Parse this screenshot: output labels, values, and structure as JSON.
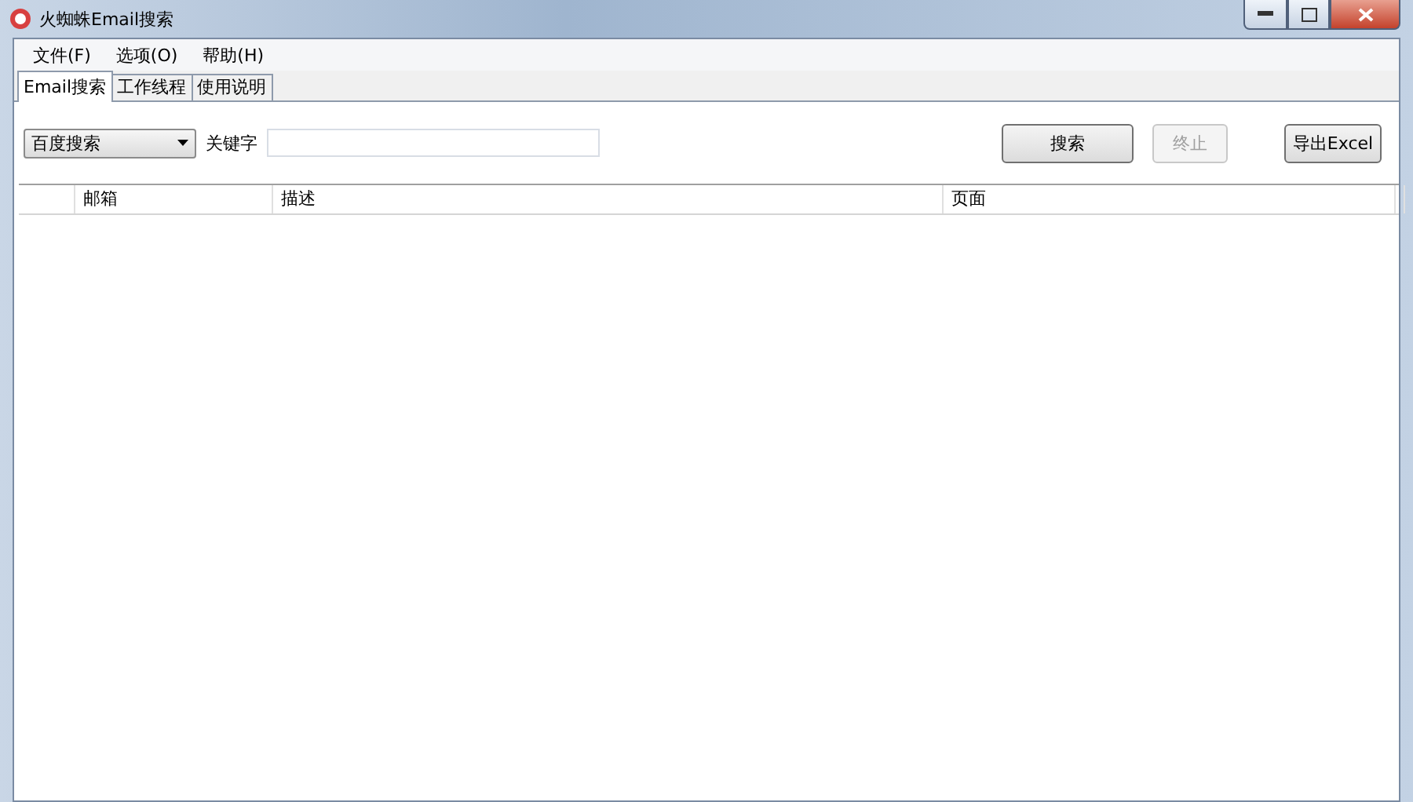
{
  "window": {
    "title": "火蜘蛛Email搜索"
  },
  "menu": [
    {
      "label": "文件(F)"
    },
    {
      "label": "选项(O)"
    },
    {
      "label": "帮助(H)"
    }
  ],
  "tabs": [
    {
      "label": "Email搜索",
      "selected": true
    },
    {
      "label": "工作线程",
      "selected": false
    },
    {
      "label": "使用说明",
      "selected": false
    }
  ],
  "search_bar": {
    "engine": "百度搜索",
    "keyword_label": "关键字",
    "buttons": [
      {
        "label": "搜索",
        "disabled": false
      },
      {
        "label": "终止",
        "disabled": true
      },
      {
        "label": "导出Excel",
        "disabled": false
      }
    ]
  },
  "table": {
    "columns": [
      "邮箱",
      "描述",
      "页面"
    ]
  }
}
